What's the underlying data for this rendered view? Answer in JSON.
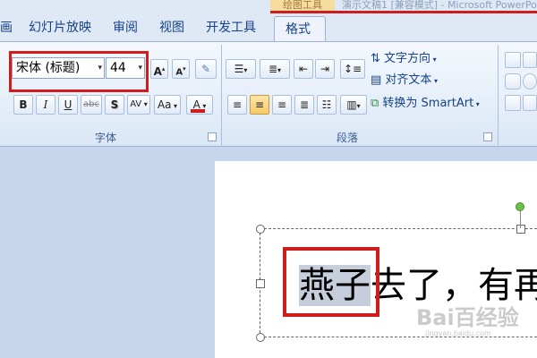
{
  "title": {
    "contextual_tab": "绘图工具",
    "window_title": "演示文稿1 [兼容模式] - Microsoft PowerPoint"
  },
  "tabs": [
    {
      "label": "画"
    },
    {
      "label": "幻灯片放映"
    },
    {
      "label": "审阅"
    },
    {
      "label": "视图"
    },
    {
      "label": "开发工具"
    },
    {
      "label": "格式"
    }
  ],
  "font_group": {
    "label": "字体",
    "font_name": "宋体 (标题)",
    "font_size": "44",
    "grow_font": "A",
    "shrink_font": "A",
    "bold": "B",
    "italic": "I",
    "underline": "U",
    "strikethrough": "abc",
    "shadow": "S",
    "char_spacing": "AV",
    "change_case": "Aa",
    "font_color": "A",
    "font_color_hex": "#d11c1c"
  },
  "paragraph_group": {
    "label": "段落",
    "text_direction": "文字方向",
    "align_text": "对齐文本",
    "convert_smartart": "转换为 SmartArt"
  },
  "slide": {
    "selected_text": "燕子",
    "rest_text": "去了，有再"
  },
  "watermark": {
    "main": "Bai百经验",
    "sub": "jingyan.baidu.com"
  }
}
